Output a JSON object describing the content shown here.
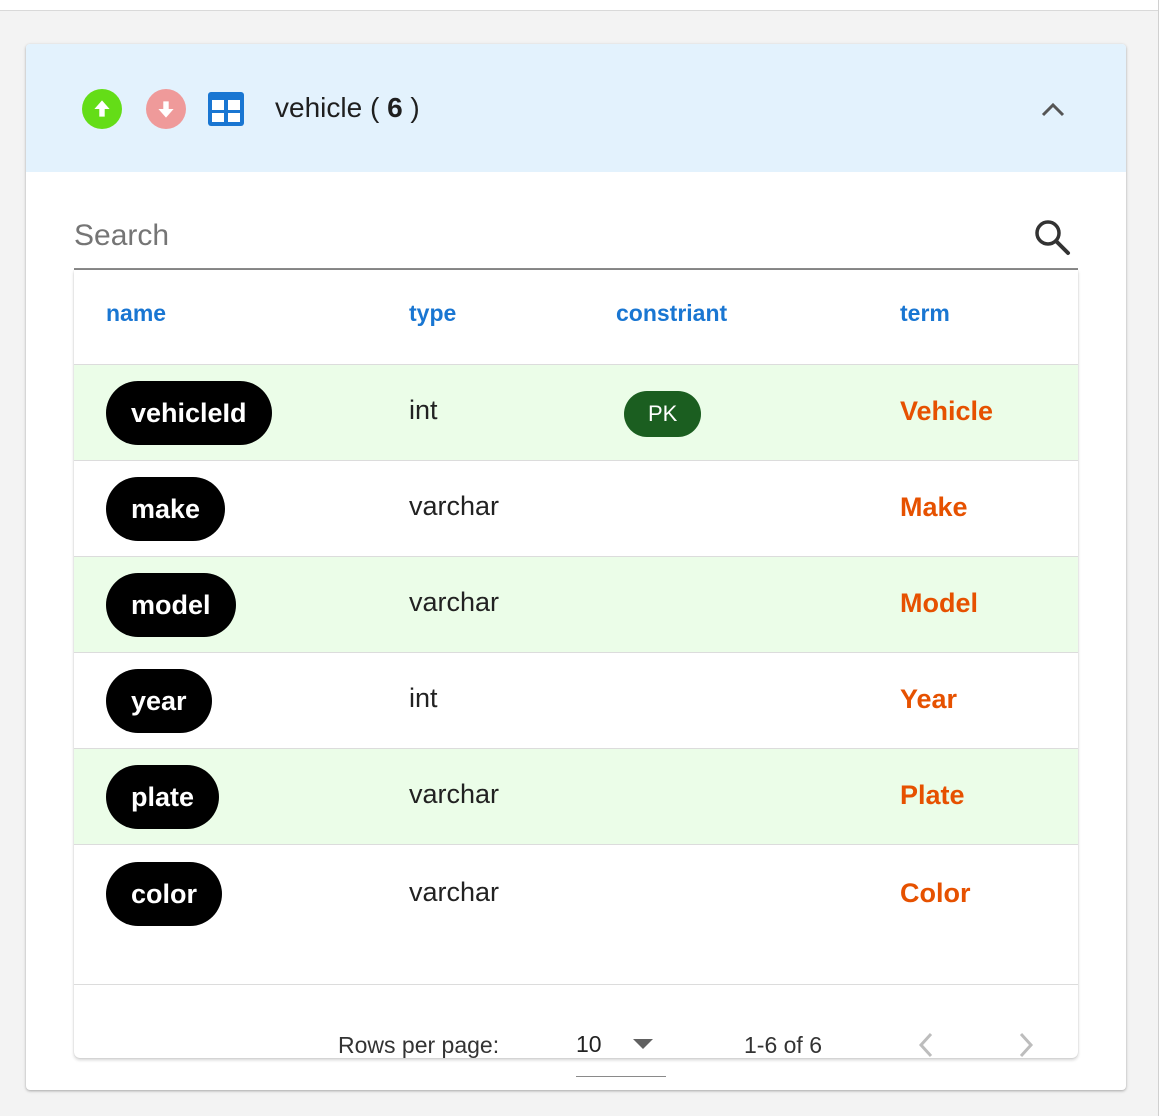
{
  "header": {
    "entity_name": "vehicle",
    "count_open": " ( ",
    "count": "6",
    "count_close": " )",
    "colors": {
      "background": "#e3f2fd",
      "up": "#64dd17",
      "down": "#ef9a9a",
      "table_icon": "#1976d2"
    },
    "icons": [
      "arrow-up-icon",
      "arrow-down-icon",
      "table-icon",
      "chevron-up-icon"
    ]
  },
  "search": {
    "placeholder": "Search",
    "value": ""
  },
  "table": {
    "columns": [
      "name",
      "type",
      "constriant",
      "term"
    ],
    "rows": [
      {
        "name": "vehicleId",
        "type": "int",
        "constraint": "PK",
        "term": "Vehicle"
      },
      {
        "name": "make",
        "type": "varchar",
        "constraint": "",
        "term": "Make"
      },
      {
        "name": "model",
        "type": "varchar",
        "constraint": "",
        "term": "Model"
      },
      {
        "name": "year",
        "type": "int",
        "constraint": "",
        "term": "Year"
      },
      {
        "name": "plate",
        "type": "varchar",
        "constraint": "",
        "term": "Plate"
      },
      {
        "name": "color",
        "type": "varchar",
        "constraint": "",
        "term": "Color"
      }
    ],
    "colors": {
      "header_text": "#1976d2",
      "alt_row": "#ebfde8",
      "term_text": "#e65100",
      "pk_chip": "#1b5e20",
      "name_chip": "#000000"
    }
  },
  "pagination": {
    "rows_per_page_label": "Rows per page:",
    "rows_per_page": "10",
    "range": "1-6 of 6"
  }
}
